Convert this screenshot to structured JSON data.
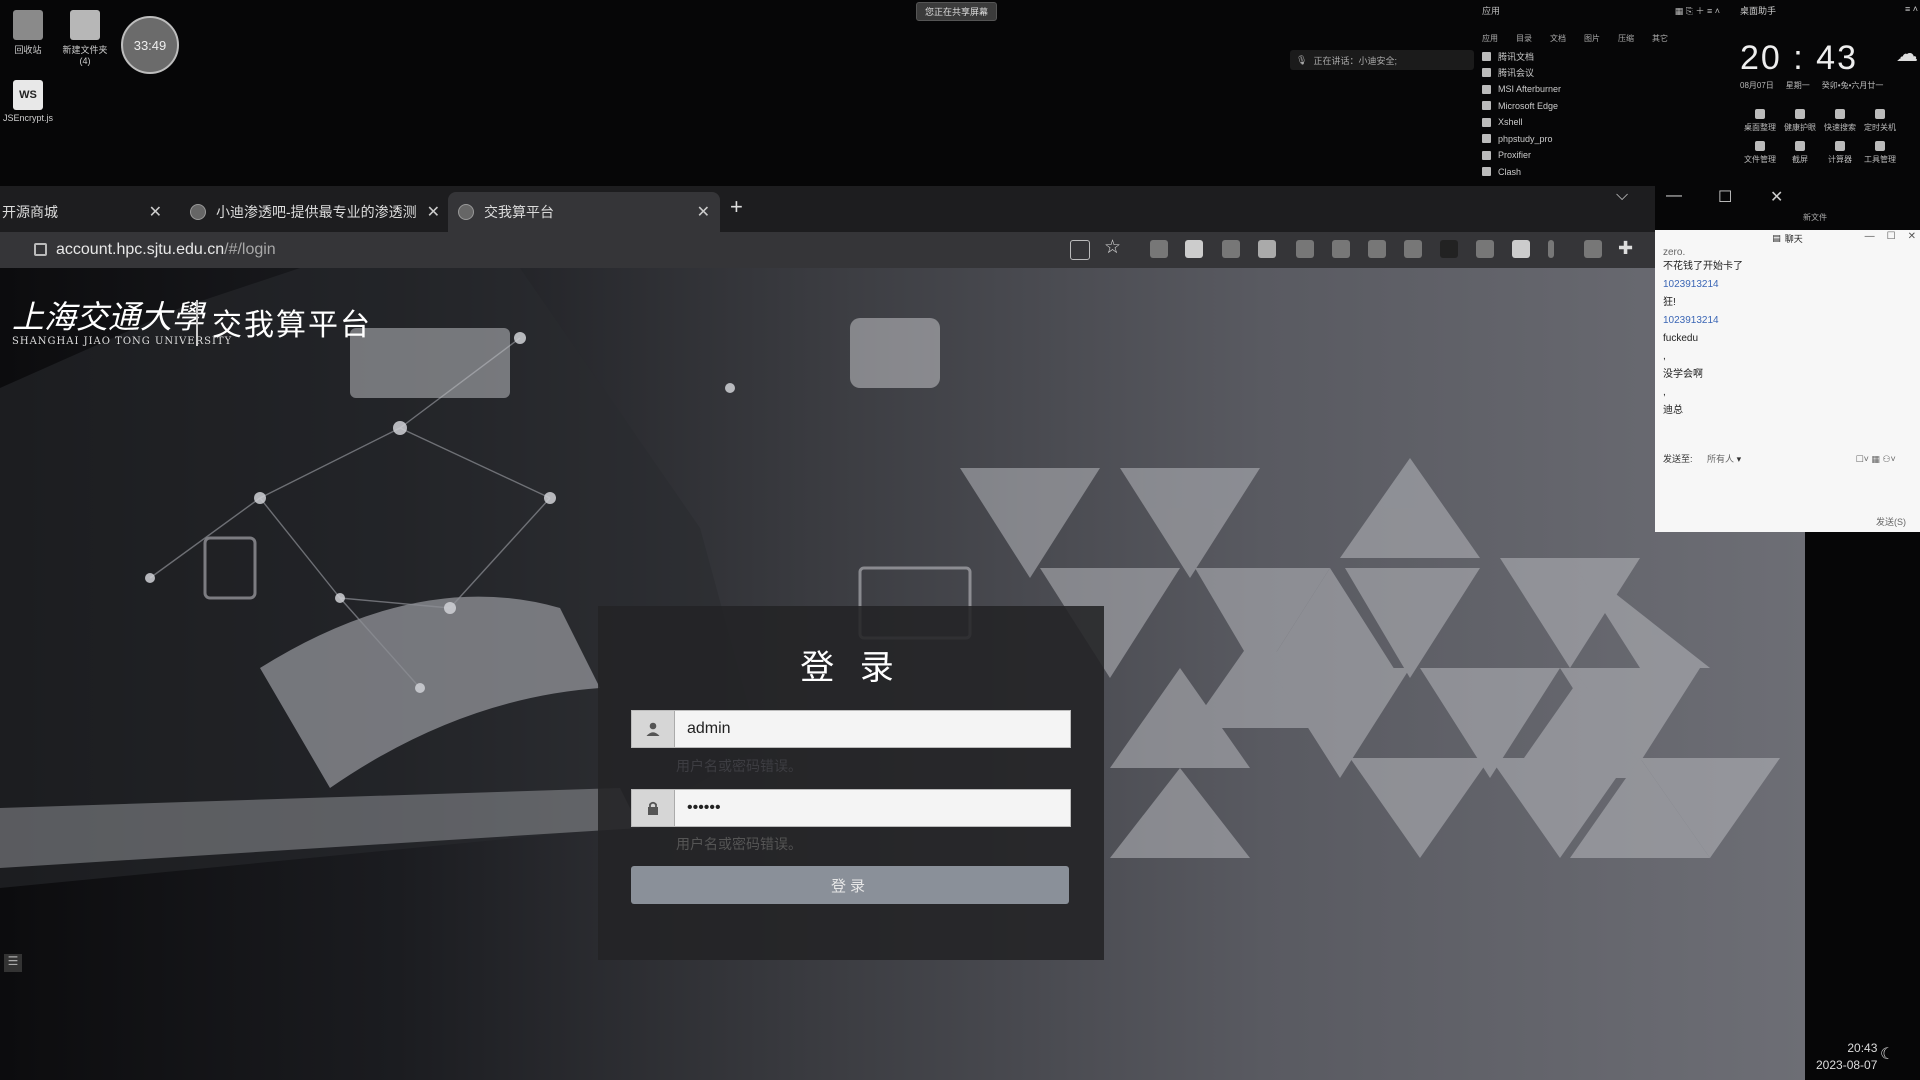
{
  "desktop": {
    "icons": [
      {
        "label": "回收站"
      },
      {
        "label": "新建文件夹\n(4)"
      },
      {
        "label": "JSEncrypt.js",
        "badge": "WS"
      }
    ],
    "timer": "33:49",
    "share_notice": "您正在共享屏幕",
    "meeting_status": "正在讲话：小迪安全;"
  },
  "app_panel": {
    "title": "应用",
    "categories": [
      "应用",
      "目录",
      "文档",
      "图片",
      "压缩",
      "其它"
    ],
    "apps": [
      "腾讯文档",
      "腾讯会议",
      "MSI Afterburner",
      "Microsoft Edge",
      "Xshell",
      "phpstudy_pro",
      "Proxifier",
      "Clash"
    ]
  },
  "clock_panel": {
    "title": "桌面助手",
    "time": "20 : 43",
    "date": "08月07日",
    "weekday": "星期一",
    "lunar": "癸卯•兔•六月廿一",
    "tools": [
      "桌面整理",
      "健康护眼",
      "快速搜索",
      "定时关机",
      "文件管理",
      "截屏",
      "计算器",
      "工具管理"
    ],
    "side_text": "新文件"
  },
  "browser": {
    "tabs": [
      {
        "title": "开源商城"
      },
      {
        "title": "小迪渗透吧-提供最专业的渗透测"
      },
      {
        "title": "交我算平台"
      }
    ],
    "url_host": "account.hpc.sjtu.edu.cn",
    "url_path": "/#/login"
  },
  "page": {
    "logo_cn": "上海交通大學",
    "logo_en": "SHANGHAI JIAO TONG UNIVERSITY",
    "platform": "交我算平台",
    "login": {
      "title": "登 录",
      "username": "admin",
      "password_mask": "••••••",
      "error_user": "用户名或密码错误。",
      "error_pass": "用户名或密码错误。",
      "button": "登录"
    }
  },
  "chat": {
    "title": "聊天",
    "messages": [
      {
        "text": "zero.",
        "kind": "text"
      },
      {
        "text": "不花钱了开始卡了",
        "kind": "text"
      },
      {
        "text": "1023913214",
        "kind": "id"
      },
      {
        "text": "狂!",
        "kind": "text"
      },
      {
        "text": "1023913214",
        "kind": "id"
      },
      {
        "text": "fuckedu",
        "kind": "text"
      },
      {
        "text": ",",
        "kind": "text"
      },
      {
        "text": "没学会啊",
        "kind": "text"
      },
      {
        "text": ",",
        "kind": "text"
      },
      {
        "text": "迪总",
        "kind": "text"
      }
    ],
    "send_to_label": "发送至:",
    "send_to_value": "所有人",
    "send_button": "发送(S)"
  },
  "taskbar": {
    "time": "20:43",
    "date": "2023-08-07"
  }
}
